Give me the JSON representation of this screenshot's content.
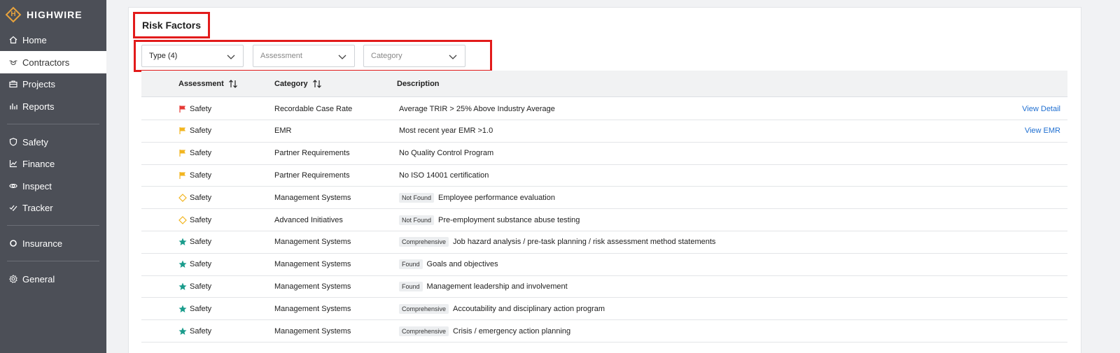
{
  "sidebar": {
    "logo": "HIGHWIRE",
    "logo_letter": "H",
    "items": [
      {
        "label": "Home",
        "icon": "home-icon"
      },
      {
        "label": "Contractors",
        "icon": "handshake-icon"
      },
      {
        "label": "Projects",
        "icon": "briefcase-icon"
      },
      {
        "label": "Reports",
        "icon": "bar-chart-icon"
      },
      {
        "label": "Safety",
        "icon": "shield-icon"
      },
      {
        "label": "Finance",
        "icon": "line-chart-icon"
      },
      {
        "label": "Inspect",
        "icon": "eye-icon"
      },
      {
        "label": "Tracker",
        "icon": "check-list-icon"
      },
      {
        "label": "Insurance",
        "icon": "ring-icon"
      },
      {
        "label": "General",
        "icon": "gear-icon"
      }
    ],
    "active": "Contractors"
  },
  "main": {
    "title": "Risk Factors",
    "filters": [
      {
        "value": "Type (4)",
        "placeholder": ""
      },
      {
        "value": "",
        "placeholder": "Assessment"
      },
      {
        "value": "",
        "placeholder": "Category"
      }
    ],
    "columns": [
      "Assessment",
      "Category",
      "Description"
    ],
    "rows": [
      {
        "icon": "red-flag-icon",
        "assessment": "Safety",
        "category": "Recordable Case Rate",
        "badge": "",
        "description": "Average TRIR > 25% Above Industry Average",
        "action": "View Detail"
      },
      {
        "icon": "yellow-flag-icon",
        "assessment": "Safety",
        "category": "EMR",
        "badge": "",
        "description": "Most recent year EMR >1.0",
        "action": "View EMR"
      },
      {
        "icon": "yellow-flag-icon",
        "assessment": "Safety",
        "category": "Partner Requirements",
        "badge": "",
        "description": "No Quality Control Program",
        "action": ""
      },
      {
        "icon": "yellow-flag-icon",
        "assessment": "Safety",
        "category": "Partner Requirements",
        "badge": "",
        "description": "No ISO 14001 certification",
        "action": ""
      },
      {
        "icon": "yellow-diamond-icon",
        "assessment": "Safety",
        "category": "Management Systems",
        "badge": "Not Found",
        "description": "Employee performance evaluation",
        "action": ""
      },
      {
        "icon": "yellow-diamond-icon",
        "assessment": "Safety",
        "category": "Advanced Initiatives",
        "badge": "Not Found",
        "description": "Pre-employment substance abuse testing",
        "action": ""
      },
      {
        "icon": "teal-star-icon",
        "assessment": "Safety",
        "category": "Management Systems",
        "badge": "Comprehensive",
        "description": "Job hazard analysis / pre-task planning / risk assessment method statements",
        "action": ""
      },
      {
        "icon": "teal-star-icon",
        "assessment": "Safety",
        "category": "Management Systems",
        "badge": "Found",
        "description": "Goals and objectives",
        "action": ""
      },
      {
        "icon": "teal-star-icon",
        "assessment": "Safety",
        "category": "Management Systems",
        "badge": "Found",
        "description": "Management leadership and involvement",
        "action": ""
      },
      {
        "icon": "teal-star-icon",
        "assessment": "Safety",
        "category": "Management Systems",
        "badge": "Comprehensive",
        "description": "Accoutability and disciplinary action program",
        "action": ""
      },
      {
        "icon": "teal-star-icon",
        "assessment": "Safety",
        "category": "Management Systems",
        "badge": "Comprehensive",
        "description": "Crisis / emergency action planning",
        "action": ""
      }
    ]
  },
  "colors": {
    "sidebar_bg": "#4c4f57",
    "brand": "#e8a33d",
    "highlight": "#e21b1b",
    "link": "#1f6fd1",
    "flag_red": "#e53935",
    "flag_yellow": "#f2b51f",
    "star_teal": "#1a9c8c"
  }
}
